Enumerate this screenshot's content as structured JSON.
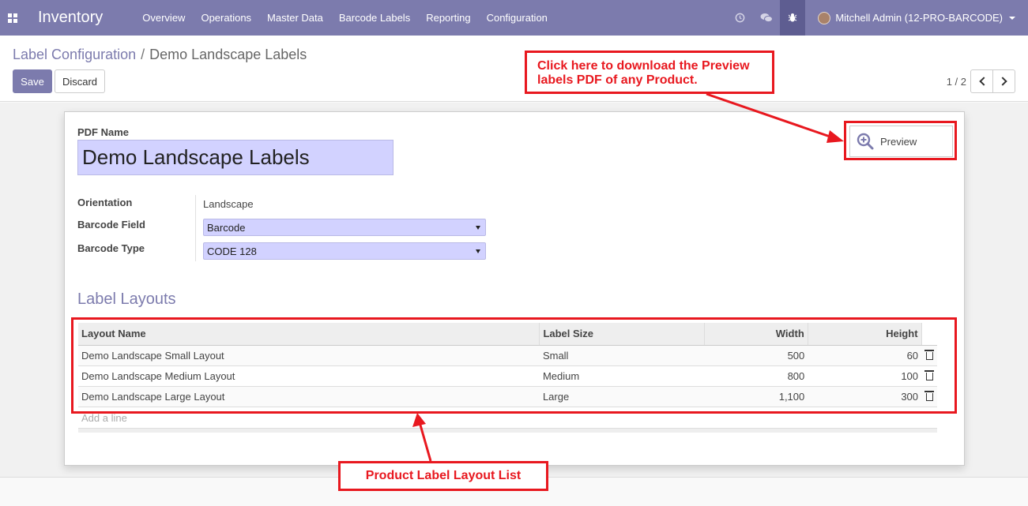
{
  "navbar": {
    "app_name": "Inventory",
    "menu": [
      "Overview",
      "Operations",
      "Master Data",
      "Barcode Labels",
      "Reporting",
      "Configuration"
    ],
    "user": "Mitchell Admin (12-PRO-BARCODE)",
    "icons": [
      "apps-grid-icon",
      "clock-icon",
      "chat-icon",
      "bug-icon"
    ],
    "color": "#7c7bad"
  },
  "breadcrumb": {
    "parent": "Label Configuration",
    "separator": "/",
    "current": "Demo Landscape Labels"
  },
  "toolbar": {
    "save_label": "Save",
    "discard_label": "Discard"
  },
  "pager": {
    "value": "1 / 2"
  },
  "form": {
    "pdf_name_label": "PDF Name",
    "pdf_name_value": "Demo Landscape Labels",
    "orientation_label": "Orientation",
    "orientation_value": "Landscape",
    "barcode_field_label": "Barcode Field",
    "barcode_field_value": "Barcode",
    "barcode_type_label": "Barcode Type",
    "barcode_type_value": "CODE 128",
    "preview_label": "Preview"
  },
  "layouts": {
    "section_title": "Label Layouts",
    "columns": [
      "Layout Name",
      "Label Size",
      "Width",
      "Height"
    ],
    "rows": [
      {
        "name": "Demo Landscape Small Layout",
        "size": "Small",
        "width": "500",
        "height": "60"
      },
      {
        "name": "Demo Landscape Medium Layout",
        "size": "Medium",
        "width": "800",
        "height": "100"
      },
      {
        "name": "Demo Landscape Large Layout",
        "size": "Large",
        "width": "1,100",
        "height": "300"
      }
    ],
    "add_line": "Add a line"
  },
  "annotations": {
    "preview_note_line1": "Click here to download the Preview",
    "preview_note_line2": "labels PDF of any Product.",
    "list_note": "Product Label Layout List",
    "color": "#e8181f"
  }
}
